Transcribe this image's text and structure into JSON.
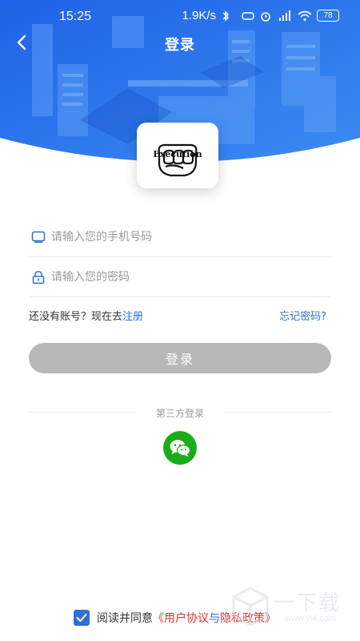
{
  "status_bar": {
    "time": "15:25",
    "network_speed": "1.9K/s",
    "battery_level": "78"
  },
  "nav": {
    "title": "登录"
  },
  "logo": {
    "text": "Execution"
  },
  "form": {
    "phone_placeholder": "请输入您的手机号码",
    "password_placeholder": "请输入您的密码",
    "register_prefix": "还没有账号？现在去",
    "register_link": "注册",
    "forgot_link": "忘记密码?",
    "login_button": "登录"
  },
  "third_party": {
    "label": "第三方登录",
    "providers": [
      "wechat"
    ]
  },
  "agreement": {
    "checked": true,
    "prefix": "阅读并同意",
    "open_bracket": "《",
    "user_agreement": "用户协议",
    "and": "与",
    "privacy_policy": "隐私政策",
    "close_bracket": "》"
  },
  "watermark": {
    "text": "一下载",
    "sub": "www.yi4.com"
  },
  "colors": {
    "header_blue": "#2a6fe8",
    "link_blue": "#2f6fd6",
    "agreement_red": "#d93434",
    "button_disabled": "#b8b8b8",
    "wechat_green": "#1aad19"
  }
}
